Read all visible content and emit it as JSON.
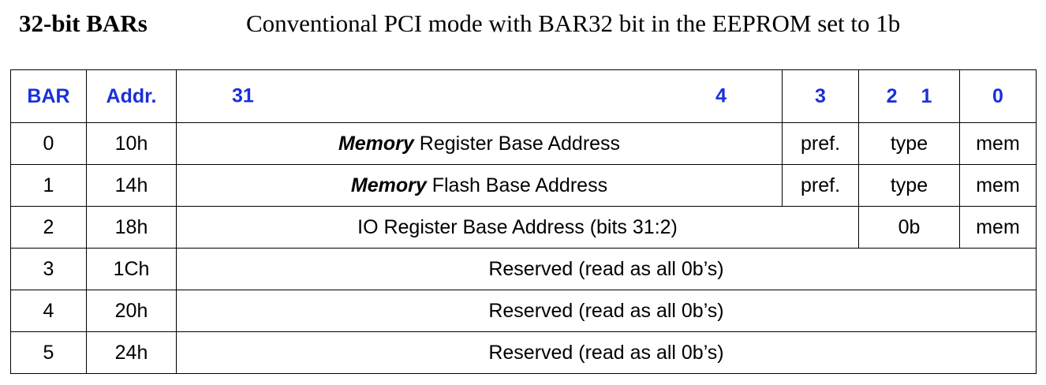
{
  "header": {
    "title": "32-bit BARs",
    "subtitle": "Conventional PCI mode with BAR32 bit in the EEPROM set to 1b"
  },
  "table": {
    "header": {
      "bar": "BAR",
      "addr": "Addr.",
      "bit_31": "31",
      "bit_4": "4",
      "bit_3": "3",
      "bit_2": "2",
      "bit_1": "1",
      "bit_0": "0"
    },
    "rows": [
      {
        "bar": "0",
        "addr": "10h",
        "desc_emphasis": "Memory",
        "desc_rest": " Register Base Address",
        "pref": "pref.",
        "type": "type",
        "mem": "mem"
      },
      {
        "bar": "1",
        "addr": "14h",
        "desc_emphasis": "Memory",
        "desc_rest": " Flash Base Address",
        "pref": "pref.",
        "type": "type",
        "mem": "mem"
      },
      {
        "bar": "2",
        "addr": "18h",
        "desc": "IO Register Base Address (bits 31:2)",
        "bit1": "0b",
        "mem": "mem"
      },
      {
        "bar": "3",
        "addr": "1Ch",
        "desc": "Reserved (read as all 0b’s)"
      },
      {
        "bar": "4",
        "addr": "20h",
        "desc": "Reserved (read as all 0b’s)"
      },
      {
        "bar": "5",
        "addr": "24h",
        "desc": "Reserved (read as all 0b’s)"
      }
    ]
  },
  "colors": {
    "header_text": "#1a30d8",
    "border": "#000000",
    "background": "#ffffff"
  }
}
